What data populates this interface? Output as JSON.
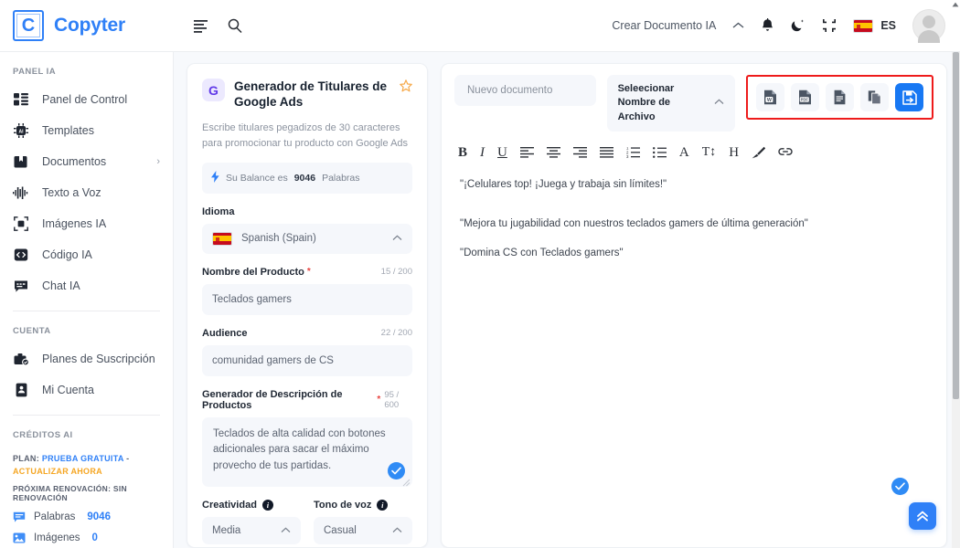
{
  "brand": {
    "mark": "C",
    "name": "Copyter"
  },
  "topbar": {
    "menu_icon": "menu-icon",
    "search_icon": "search-icon",
    "create_doc_label": "Crear Documento IA",
    "caret": "⌃",
    "notifications_icon": "bell-icon",
    "theme_icon": "moon-icon",
    "fullscreen_icon": "compress-icon",
    "lang_code": "ES",
    "avatar": "user-avatar"
  },
  "sidebar": {
    "section_panel_title": "PANEL IA",
    "items": [
      {
        "label": "Panel de Control",
        "icon": "dashboard-icon",
        "chevron": ""
      },
      {
        "label": "Templates",
        "icon": "chip-ai-icon",
        "chevron": ""
      },
      {
        "label": "Documentos",
        "icon": "documents-icon",
        "chevron": "›"
      },
      {
        "label": "Texto a Voz",
        "icon": "waveform-icon",
        "chevron": ""
      },
      {
        "label": "Imágenes IA",
        "icon": "image-ai-icon",
        "chevron": ""
      },
      {
        "label": "Código IA",
        "icon": "code-icon",
        "chevron": ""
      },
      {
        "label": "Chat IA",
        "icon": "chat-icon",
        "chevron": ""
      }
    ],
    "section_account_title": "CUENTA",
    "account_items": [
      {
        "label": "Planes de Suscripción",
        "icon": "briefcase-check-icon"
      },
      {
        "label": "Mi Cuenta",
        "icon": "id-card-icon"
      }
    ],
    "section_credits_title": "CRÉDITOS AI",
    "plan_prefix": "PLAN:",
    "plan_value": "PRUEBA GRATUITA",
    "plan_dash": "-",
    "plan_upgrade": "ACTUALIZAR AHORA",
    "renewal": "PRÓXIMA RENOVACIÓN: SIN RENOVACIÓN",
    "credits": [
      {
        "name": "Palabras",
        "value": "9046",
        "icon": "chat-bubble-icon"
      },
      {
        "name": "Imágenes",
        "value": "0",
        "icon": "image-icon"
      }
    ]
  },
  "form": {
    "logo_letter": "G",
    "title": "Generador de Titulares de Google Ads",
    "star_icon": "star-icon",
    "description": "Escribe titulares pegadizos de 30 caracteres para promocionar tu producto con Google Ads",
    "balance_prefix": "Su Balance es",
    "balance_value": "9046",
    "balance_suffix": "Palabras",
    "language_label": "Idioma",
    "language_value": "Spanish (Spain)",
    "product_label": "Nombre del Producto",
    "product_counter": "15 / 200",
    "product_value": "Teclados gamers",
    "audience_label": "Audience",
    "audience_counter": "22 / 200",
    "audience_value": "comunidad gamers de CS",
    "description_label": "Generador de Descripción de Productos",
    "description_counter": "95 / 600",
    "description_value": "Teclados de alta calidad con botones adicionales para sacar el máximo provecho de tus partidas.",
    "creativity_label": "Creatividad",
    "creativity_value": "Media",
    "tone_label": "Tono de voz",
    "tone_value": "Casual"
  },
  "editor": {
    "doc_name_placeholder": "Nuevo documento",
    "file_select_label": "Seleecionar Nombre de Archivo",
    "format_tools": [
      {
        "name": "bold-icon",
        "glyph": "B"
      },
      {
        "name": "italic-icon",
        "glyph": "I"
      },
      {
        "name": "underline-icon",
        "glyph": "U"
      },
      {
        "name": "align-left-icon",
        "glyph": ""
      },
      {
        "name": "align-center-icon",
        "glyph": ""
      },
      {
        "name": "align-right-icon",
        "glyph": ""
      },
      {
        "name": "align-justify-icon",
        "glyph": ""
      },
      {
        "name": "ordered-list-icon",
        "glyph": ""
      },
      {
        "name": "unordered-list-icon",
        "glyph": ""
      },
      {
        "name": "font-family-icon",
        "glyph": "A"
      },
      {
        "name": "font-size-icon",
        "glyph": "T↕"
      },
      {
        "name": "heading-icon",
        "glyph": "H"
      },
      {
        "name": "highlight-brush-icon",
        "glyph": ""
      },
      {
        "name": "link-icon",
        "glyph": ""
      }
    ],
    "export_buttons": [
      {
        "name": "export-word-button",
        "label": "W"
      },
      {
        "name": "export-pdf-button",
        "label": "PDF"
      },
      {
        "name": "export-text-button",
        "label": ""
      },
      {
        "name": "copy-document-button",
        "label": ""
      },
      {
        "name": "save-document-button",
        "label": ""
      }
    ],
    "content_lines": [
      "\"¡Celulares top! ¡Juega y trabaja sin límites!\"",
      "\"Mejora tu jugabilidad con nuestros teclados gamers de última generación\"",
      "\"Domina CS con Teclados gamers\""
    ],
    "scroll_top_icon": "chevron-double-up-icon",
    "confirm_icon": "check-circle-icon"
  },
  "colors": {
    "brand_blue": "#2f80f7",
    "accent_orange": "#f5a623",
    "highlight_red": "#ee1b1b",
    "panel_bg": "#f7f9fc",
    "field_bg": "#f5f7fb"
  }
}
